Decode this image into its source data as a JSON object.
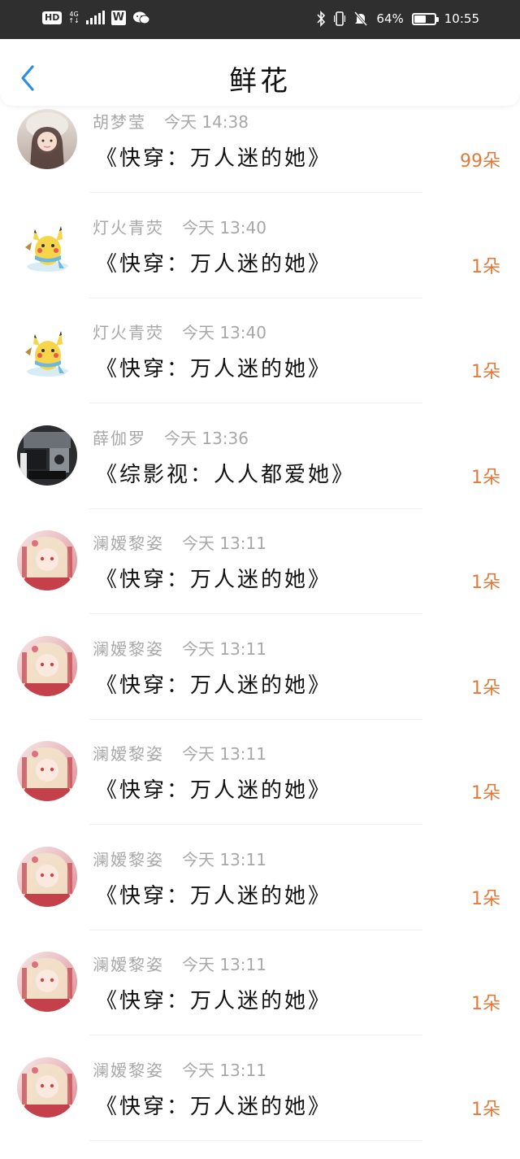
{
  "status_bar": {
    "hd": "HD",
    "net": "4G",
    "net_sub": "↑↓",
    "app_w": "W",
    "battery_percent": "64%",
    "battery_level": 0.64,
    "time": "10:55"
  },
  "header": {
    "title": "鲜花"
  },
  "rows": [
    {
      "name": "胡梦莹",
      "time": "今天 14:38",
      "book": "《快穿：万人迷的她》",
      "count": "99朵",
      "avatar": "girl"
    },
    {
      "name": "灯火青荧",
      "time": "今天 13:40",
      "book": "《快穿：万人迷的她》",
      "count": "1朵",
      "avatar": "pikachu"
    },
    {
      "name": "灯火青荧",
      "time": "今天 13:40",
      "book": "《快穿：万人迷的她》",
      "count": "1朵",
      "avatar": "pikachu"
    },
    {
      "name": "薛伽罗",
      "time": "今天 13:36",
      "book": "《综影视：人人都爱她》",
      "count": "1朵",
      "avatar": "dark"
    },
    {
      "name": "澜嫒黎姿",
      "time": "今天 13:11",
      "book": "《快穿：万人迷的她》",
      "count": "1朵",
      "avatar": "anime"
    },
    {
      "name": "澜嫒黎姿",
      "time": "今天 13:11",
      "book": "《快穿：万人迷的她》",
      "count": "1朵",
      "avatar": "anime"
    },
    {
      "name": "澜嫒黎姿",
      "time": "今天 13:11",
      "book": "《快穿：万人迷的她》",
      "count": "1朵",
      "avatar": "anime"
    },
    {
      "name": "澜嫒黎姿",
      "time": "今天 13:11",
      "book": "《快穿：万人迷的她》",
      "count": "1朵",
      "avatar": "anime"
    },
    {
      "name": "澜嫒黎姿",
      "time": "今天 13:11",
      "book": "《快穿：万人迷的她》",
      "count": "1朵",
      "avatar": "anime"
    },
    {
      "name": "澜嫒黎姿",
      "time": "今天 13:11",
      "book": "《快穿：万人迷的她》",
      "count": "1朵",
      "avatar": "anime"
    }
  ],
  "colors": {
    "status_bar_bg": "#2f2f2f",
    "accent_back": "#2a8fe8",
    "count_orange": "#e07a3a",
    "meta_gray": "#a8a8a8"
  }
}
